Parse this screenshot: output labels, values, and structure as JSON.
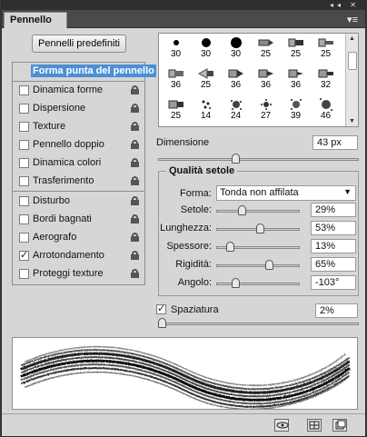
{
  "window": {
    "title_icons": "◂◂ ✕"
  },
  "panel": {
    "tab_label": "Pennello",
    "menu_icon": "menu-icon"
  },
  "preset_button": {
    "label": "Pennelli predefiniti"
  },
  "sidebar": {
    "header": "Forma punta del pennello",
    "items": [
      {
        "label": "Dinamica forme",
        "checked": false
      },
      {
        "label": "Dispersione",
        "checked": false
      },
      {
        "label": "Texture",
        "checked": false
      },
      {
        "label": "Pennello doppio",
        "checked": false
      },
      {
        "label": "Dinamica colori",
        "checked": false
      },
      {
        "label": "Trasferimento",
        "checked": false
      },
      {
        "label": "Disturbo",
        "checked": false
      },
      {
        "label": "Bordi bagnati",
        "checked": false
      },
      {
        "label": "Aerografo",
        "checked": false
      },
      {
        "label": "Arrotondamento",
        "checked": true
      },
      {
        "label": "Proteggi texture",
        "checked": false
      }
    ]
  },
  "brush_grid": {
    "rows": [
      [
        "30",
        "30",
        "30",
        "25",
        "25",
        "25"
      ],
      [
        "36",
        "25",
        "36",
        "36",
        "36",
        "32"
      ],
      [
        "25",
        "14",
        "24",
        "27",
        "39",
        "46"
      ]
    ]
  },
  "dimension": {
    "label": "Dimensione",
    "value": "43 px",
    "slider_fraction": 0.38
  },
  "bristle": {
    "title": "Qualità setole",
    "shape_label": "Forma:",
    "shape_value": "Tonda non affilata",
    "params": [
      {
        "label": "Setole:",
        "value": "29%",
        "fraction": 0.29
      },
      {
        "label": "Lunghezza:",
        "value": "53%",
        "fraction": 0.53
      },
      {
        "label": "Spessore:",
        "value": "13%",
        "fraction": 0.13
      },
      {
        "label": "Rigidità:",
        "value": "65%",
        "fraction": 0.65
      },
      {
        "label": "Angolo:",
        "value": "-103°",
        "fraction": 0.21
      }
    ]
  },
  "spacing": {
    "label": "Spaziatura",
    "value": "2%",
    "checked": true,
    "fraction": 0.0
  },
  "colors": {
    "selection": "#4c8fd6",
    "panel_bg": "#d6d6d6"
  }
}
